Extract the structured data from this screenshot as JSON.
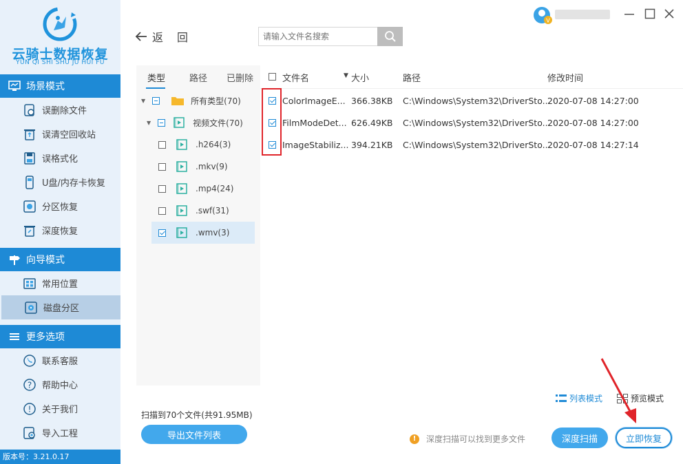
{
  "app": {
    "logo_cn": "云骑士数据恢复",
    "logo_en": "YUN QI SHI SHU JU HUI FU",
    "version": "版本号：3.21.0.17"
  },
  "sidebar": {
    "sections": [
      {
        "title": "场景模式",
        "icon": "monitor-icon",
        "items": [
          {
            "label": "误删除文件",
            "icon": "file-recover-icon"
          },
          {
            "label": "误清空回收站",
            "icon": "recycle-bin-icon"
          },
          {
            "label": "误格式化",
            "icon": "format-disk-icon"
          },
          {
            "label": "U盘/内存卡恢复",
            "icon": "usb-card-icon"
          },
          {
            "label": "分区恢复",
            "icon": "partition-icon"
          },
          {
            "label": "深度恢复",
            "icon": "deep-recover-icon"
          }
        ]
      },
      {
        "title": "向导模式",
        "icon": "signpost-icon",
        "items": [
          {
            "label": "常用位置",
            "icon": "windows-icon"
          },
          {
            "label": "磁盘分区",
            "icon": "disk-icon",
            "active": true
          }
        ]
      },
      {
        "title": "更多选项",
        "icon": "menu-icon",
        "items": [
          {
            "label": "联系客服",
            "icon": "phone-icon"
          },
          {
            "label": "帮助中心",
            "icon": "help-icon"
          },
          {
            "label": "关于我们",
            "icon": "info-icon"
          },
          {
            "label": "导入工程",
            "icon": "import-icon"
          }
        ]
      }
    ]
  },
  "header": {
    "back_label": "返回",
    "search_placeholder": "请输入文件名搜索"
  },
  "filter": {
    "tabs": [
      "类型",
      "路径",
      "已删除"
    ],
    "active_tab": "类型",
    "tree": [
      {
        "label": "所有类型(70)",
        "state": "partial",
        "level": 0,
        "expanded": true,
        "icon": "folder-icon"
      },
      {
        "label": "视频文件(70)",
        "state": "partial",
        "level": 1,
        "expanded": true,
        "icon": "video-file-icon"
      },
      {
        "label": ".h264(3)",
        "state": "unchecked",
        "level": 2,
        "icon": "video-file-icon"
      },
      {
        "label": ".mkv(9)",
        "state": "unchecked",
        "level": 2,
        "icon": "video-file-icon"
      },
      {
        "label": ".mp4(24)",
        "state": "unchecked",
        "level": 2,
        "icon": "video-file-icon"
      },
      {
        "label": ".swf(31)",
        "state": "unchecked",
        "level": 2,
        "icon": "video-file-icon"
      },
      {
        "label": ".wmv(3)",
        "state": "checked",
        "level": 2,
        "icon": "video-file-icon",
        "selected": true
      }
    ]
  },
  "table": {
    "headers": {
      "name": "文件名",
      "size": "大小",
      "path": "路径",
      "modified": "修改时间"
    },
    "rows": [
      {
        "name": "ColorImageE...",
        "size": "366.38KB",
        "path": "C:\\Windows\\System32\\DriverSto...",
        "modified": "2020-07-08 14:27:00",
        "checked": true
      },
      {
        "name": "FilmModeDet...",
        "size": "626.49KB",
        "path": "C:\\Windows\\System32\\DriverSto...",
        "modified": "2020-07-08 14:27:00",
        "checked": true
      },
      {
        "name": "ImageStabiliz...",
        "size": "394.21KB",
        "path": "C:\\Windows\\System32\\DriverSto...",
        "modified": "2020-07-08 14:27:14",
        "checked": true
      }
    ]
  },
  "view_modes": {
    "list": "列表模式",
    "preview": "预览模式"
  },
  "footer": {
    "scan_info": "扫描到70个文件(共91.95MB)",
    "export_label": "导出文件列表",
    "tip": "深度扫描可以找到更多文件",
    "deep_scan_label": "深度扫描",
    "recover_label": "立即恢复"
  },
  "colors": {
    "accent": "#1e8ad6",
    "button": "#42a8ec",
    "annotation_red": "#e0242a",
    "sidebar_bg": "#e8f1fa"
  }
}
